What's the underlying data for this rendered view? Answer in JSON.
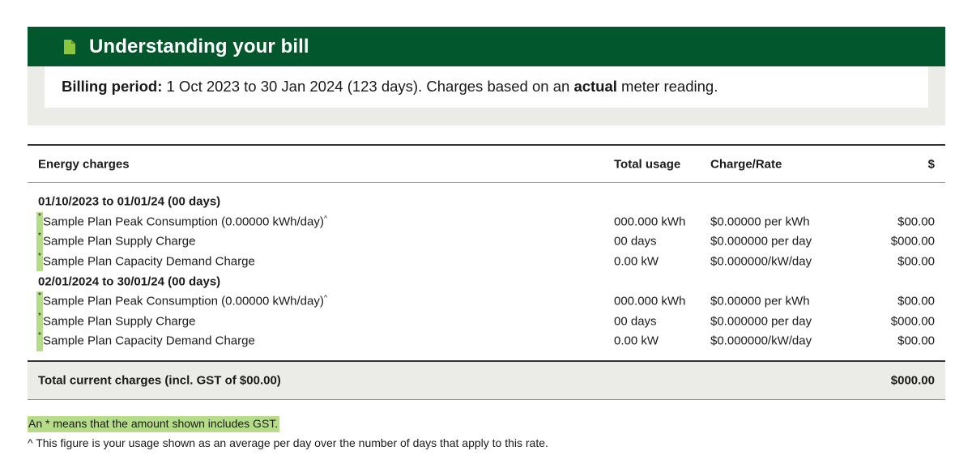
{
  "header": {
    "title": "Understanding your bill",
    "icon": "document-icon",
    "color": "#03572c"
  },
  "billing": {
    "label": "Billing period:",
    "text_before": " 1 Oct 2023 to 30 Jan 2024 (123 days). Charges based on an ",
    "emphasis": "actual",
    "text_after": " meter reading."
  },
  "table": {
    "columns": [
      "Energy charges",
      "Total usage",
      "Charge/Rate",
      "$"
    ],
    "sections": [
      {
        "title": "01/10/2023 to 01/01/24 (00 days)",
        "rows": [
          {
            "star": "*",
            "label": "Sample Plan Peak Consumption (0.00000 kWh/day)",
            "caret": "^",
            "usage": "000.000 kWh",
            "rate": "$0.00000 per kWh",
            "amount": "$00.00"
          },
          {
            "star": "*",
            "label": "Sample Plan Supply Charge",
            "caret": "",
            "usage": "00 days",
            "rate": "$0.000000 per day",
            "amount": "$000.00"
          },
          {
            "star": "*",
            "label": "Sample Plan Capacity Demand Charge",
            "caret": "",
            "usage": "0.00 kW",
            "rate": "$0.000000/kW/day",
            "amount": "$00.00"
          }
        ]
      },
      {
        "title": "02/01/2024 to 30/01/24 (00 days)",
        "rows": [
          {
            "star": "*",
            "label": "Sample Plan Peak Consumption (0.00000 kWh/day)",
            "caret": "^",
            "usage": "000.000 kWh",
            "rate": "$0.00000 per kWh",
            "amount": "$00.00"
          },
          {
            "star": "*",
            "label": "Sample Plan Supply Charge",
            "caret": "",
            "usage": "00 days",
            "rate": "$0.000000 per day",
            "amount": "$000.00"
          },
          {
            "star": "*",
            "label": "Sample Plan Capacity Demand Charge",
            "caret": "",
            "usage": "0.00 kW",
            "rate": "$0.000000/kW/day",
            "amount": "$00.00"
          }
        ]
      }
    ],
    "total": {
      "label": "Total current charges (incl. GST of $00.00)",
      "amount": "$000.00"
    }
  },
  "notes": {
    "gst": "An * means that the amount shown includes GST.",
    "average": "^ This figure is your usage shown as an average per day over the number of days that apply to this rate."
  },
  "colors": {
    "highlight": "#b6dc8a",
    "panel": "#ebece8"
  }
}
